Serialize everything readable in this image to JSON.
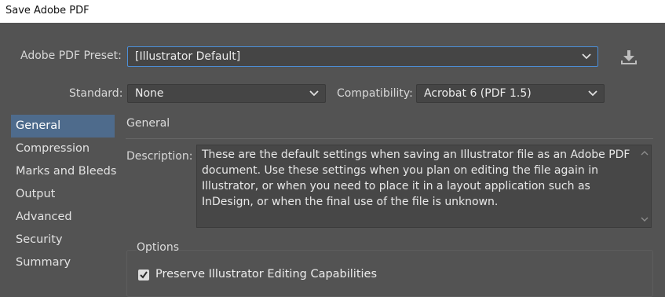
{
  "window": {
    "title": "Save Adobe PDF"
  },
  "preset": {
    "label": "Adobe PDF Preset:",
    "value": "[Illustrator Default]"
  },
  "standard": {
    "label": "Standard:",
    "value": "None"
  },
  "compatibility": {
    "label": "Compatibility:",
    "value": "Acrobat 6 (PDF 1.5)"
  },
  "sidebar": {
    "items": [
      {
        "label": "General",
        "selected": true
      },
      {
        "label": "Compression"
      },
      {
        "label": "Marks and Bleeds"
      },
      {
        "label": "Output"
      },
      {
        "label": "Advanced"
      },
      {
        "label": "Security"
      },
      {
        "label": "Summary"
      }
    ]
  },
  "general": {
    "section_title": "General",
    "description_label": "Description:",
    "description_lines": [
      "These are the default settings when saving an Illustrator file as an Adobe PDF",
      "document. Use these settings when you plan on editing the file again in",
      "Illustrator, or when you need to place it in a layout application such as",
      "InDesign, or when the final use of the file is unknown."
    ],
    "options_title": "Options",
    "preserve_label": "Preserve Illustrator Editing Capabilities",
    "preserve_checked": true
  },
  "colors": {
    "background": "#535353",
    "selection": "#4e6b8c",
    "focus_border": "#4c8fd8"
  },
  "icons": {
    "save_preset": "download-icon",
    "dropdown": "chevron-down-icon",
    "check": "checkmark-icon"
  }
}
